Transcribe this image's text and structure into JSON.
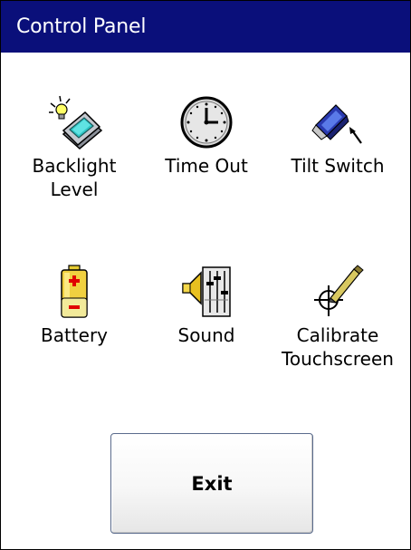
{
  "window": {
    "title": "Control Panel"
  },
  "items": [
    {
      "label": "Backlight\nLevel",
      "icon": "backlight-icon"
    },
    {
      "label": "Time Out",
      "icon": "clock-icon"
    },
    {
      "label": "Tilt Switch",
      "icon": "tilt-switch-icon"
    },
    {
      "label": "Battery",
      "icon": "battery-icon"
    },
    {
      "label": "Sound",
      "icon": "speaker-icon"
    },
    {
      "label": "Calibrate\nTouchscreen",
      "icon": "crosshair-stylus-icon"
    }
  ],
  "exit_button": {
    "label": "Exit"
  },
  "colors": {
    "titlebar": "#0a0f7a",
    "title_text": "#ffffff",
    "background": "#ffffff"
  }
}
